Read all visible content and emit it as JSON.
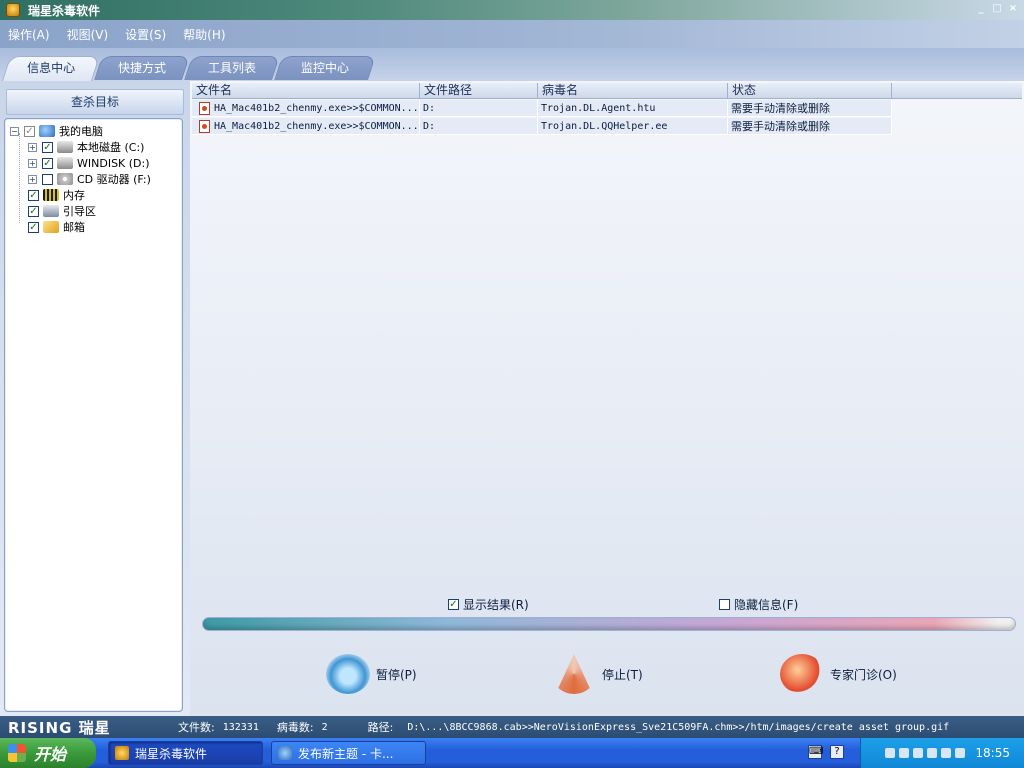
{
  "window": {
    "title": "瑞星杀毒软件",
    "buttons": [
      "_",
      "□",
      "×"
    ]
  },
  "menu": [
    "操作(A)",
    "视图(V)",
    "设置(S)",
    "帮助(H)"
  ],
  "tabs": [
    {
      "label": "信息中心",
      "active": true
    },
    {
      "label": "快捷方式",
      "active": false
    },
    {
      "label": "工具列表",
      "active": false
    },
    {
      "label": "监控中心",
      "active": false
    }
  ],
  "left_panel": {
    "header": "查杀目标",
    "tree": [
      {
        "label": "我的电脑",
        "checked": "partial",
        "expand": "−",
        "icon": "computer-icon"
      },
      {
        "label": "本地磁盘 (C:)",
        "checked": true,
        "expand": "+",
        "icon": "hard-disk-icon"
      },
      {
        "label": "WINDISK (D:)",
        "checked": true,
        "expand": "+",
        "icon": "hard-disk-icon"
      },
      {
        "label": "CD 驱动器 (F:)",
        "checked": false,
        "expand": "+",
        "icon": "cd-drive-icon"
      },
      {
        "label": "内存",
        "checked": true,
        "icon": "memory-icon"
      },
      {
        "label": "引导区",
        "checked": true,
        "icon": "boot-sector-icon"
      },
      {
        "label": "邮箱",
        "checked": true,
        "icon": "mail-icon"
      }
    ]
  },
  "table": {
    "columns": [
      "文件名",
      "文件路径",
      "病毒名",
      "状态"
    ],
    "rows": [
      {
        "file": "HA_Mac401b2_chenmy.exe>>$COMMON...",
        "path": "D:",
        "virus": "Trojan.DL.Agent.htu",
        "status": "需要手动清除或删除"
      },
      {
        "file": "HA_Mac401b2_chenmy.exe>>$COMMON...",
        "path": "D:",
        "virus": "Trojan.DL.QQHelper.ee",
        "status": "需要手动清除或删除"
      }
    ]
  },
  "options": {
    "show_results": {
      "label": "显示结果(R)",
      "checked": true
    },
    "hide_info": {
      "label": "隐藏信息(F)",
      "checked": false
    }
  },
  "progress": 0.98,
  "actions": {
    "pause": "暂停(P)",
    "stop": "停止(T)",
    "expert": "专家门诊(O)"
  },
  "status": {
    "brand": "RISING 瑞星",
    "files_label": "文件数:",
    "files_value": "132331",
    "virus_label": "病毒数:",
    "virus_value": "2",
    "path_label": "路径:",
    "path_value": "D:\\...\\8BCC9868.cab>>NeroVisionExpress_Sve21C509FA.chm>>/htm/images/create asset group.gif"
  },
  "taskbar": {
    "start": "开始",
    "tasks": [
      {
        "label": "瑞星杀毒软件",
        "active": true
      },
      {
        "label": "发布新主题 - 卡...",
        "active": false
      }
    ],
    "clock": "18:55"
  }
}
